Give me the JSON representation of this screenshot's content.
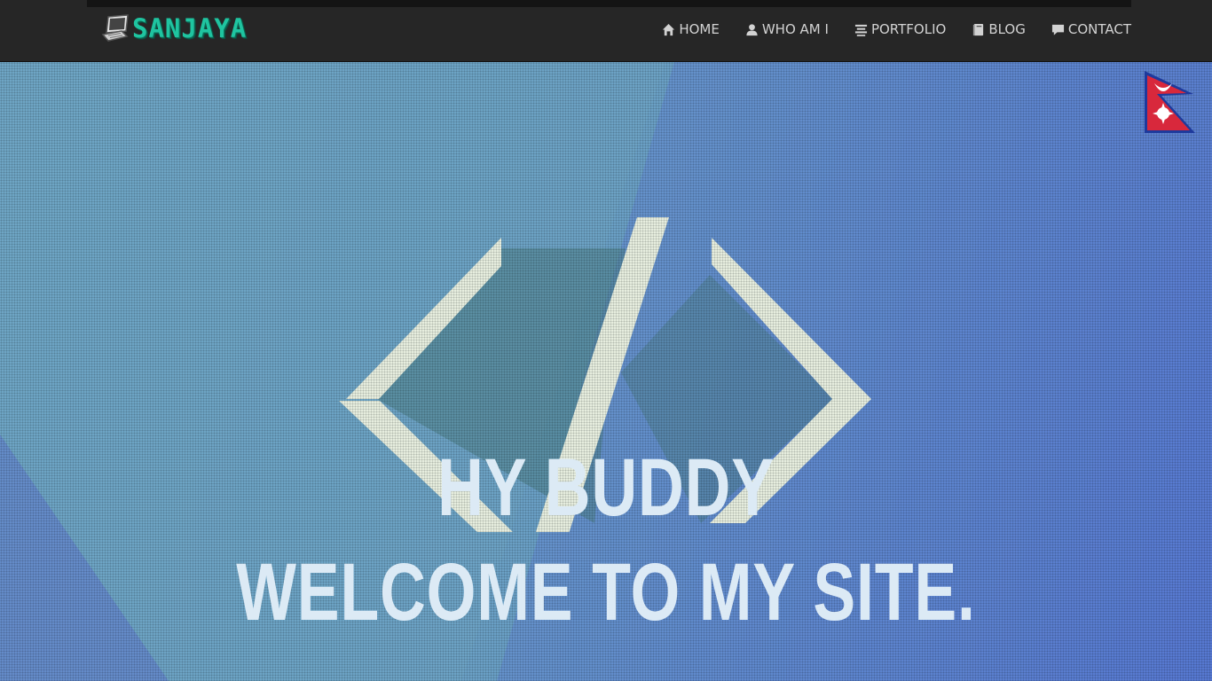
{
  "brand": {
    "name": "SANJAYA",
    "icon": "laptop-icon",
    "color": "#1fc4a0"
  },
  "nav": {
    "items": [
      {
        "label": "HOME",
        "icon": "home-icon"
      },
      {
        "label": "WHO AM I",
        "icon": "user-icon"
      },
      {
        "label": "PORTFOLIO",
        "icon": "list-icon"
      },
      {
        "label": "BLOG",
        "icon": "book-icon"
      },
      {
        "label": "CONTACT",
        "icon": "comment-icon"
      }
    ]
  },
  "hero": {
    "line1": "HY BUDDY",
    "line2": "WELCOME TO MY SITE.",
    "emblem": "code-diamond-logo",
    "flag": "nepal-flag-icon",
    "colors": {
      "left": "#6fa7c5",
      "right": "#5479d0",
      "text": "#dceaf5"
    }
  }
}
